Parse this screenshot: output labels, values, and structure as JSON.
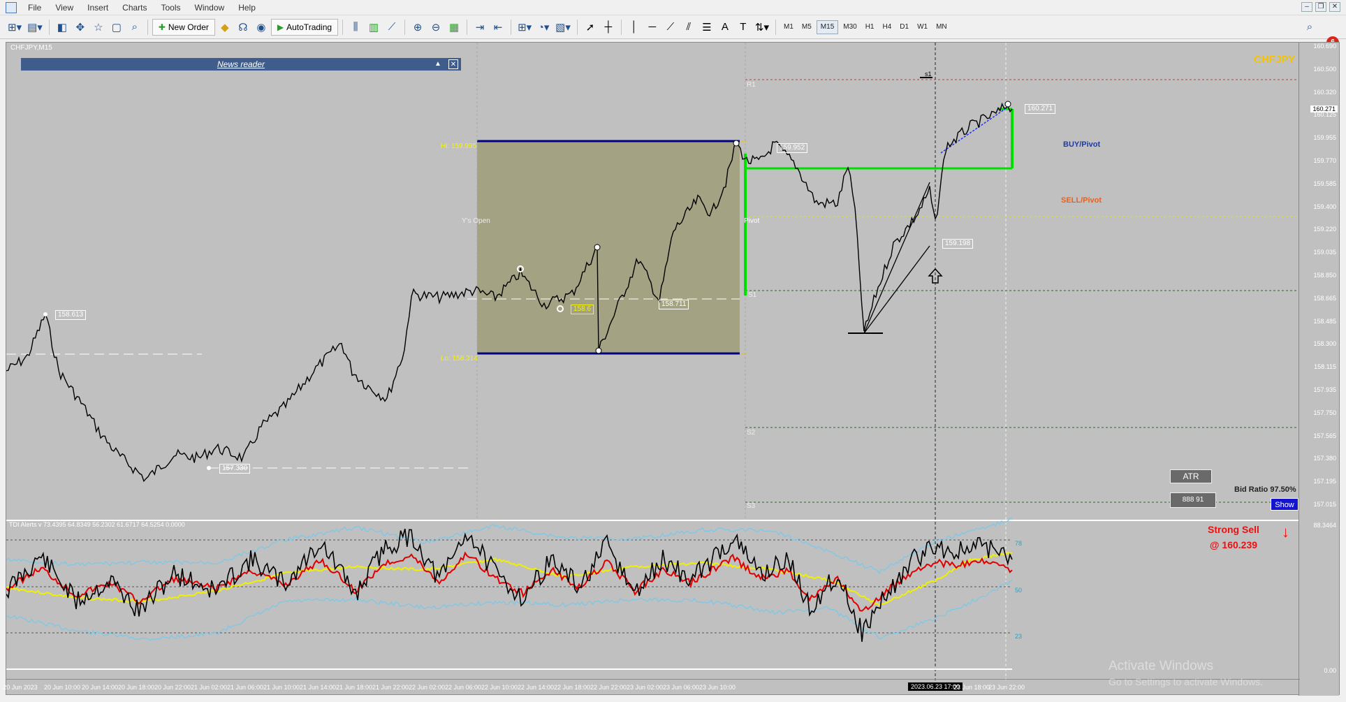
{
  "menu": [
    "File",
    "View",
    "Insert",
    "Charts",
    "Tools",
    "Window",
    "Help"
  ],
  "toolbar": {
    "new_order": "New Order",
    "autotrading": "AutoTrading",
    "timeframes": [
      "M1",
      "M5",
      "M15",
      "M30",
      "H1",
      "H4",
      "D1",
      "W1",
      "MN"
    ],
    "active_timeframe": "M15",
    "notifications": "6"
  },
  "chart": {
    "title": "CHFJPY,M15",
    "symbol": "CHFJPY",
    "news_reader": "News reader",
    "hi_label": "Hi: 159.995",
    "lo_label": "Lo: 158.314",
    "ys_open": "Y's Open",
    "pivot_label": "Pivot",
    "r1": "R1",
    "s1": "S1",
    "s2": "S2",
    "s3": "S3",
    "s1_marker": "s1",
    "buy_pivot": "BUY/Pivot",
    "sell_pivot": "SELL/Pivot",
    "tags": [
      "158.613",
      "157.330",
      "158.6",
      "158.711",
      "159.952",
      "159.198",
      "160.271"
    ],
    "atr_button": "ATR",
    "atr_value": "888 91",
    "bid_ratio": "Bid Ratio 97.50%",
    "show_button": "Show",
    "current_price": "160.271",
    "price_axis": [
      "160.690",
      "160.500",
      "160.320",
      "160.125",
      "159.955",
      "159.770",
      "159.585",
      "159.400",
      "159.220",
      "159.035",
      "158.850",
      "158.665",
      "158.485",
      "158.300",
      "158.115",
      "157.935",
      "157.750",
      "157.565",
      "157.380",
      "157.195",
      "157.015"
    ],
    "colors": {
      "background": "#c0c0c0",
      "box": "#a3a283",
      "green": "#00e000",
      "navy": "#000080",
      "yellow": "#f5c400"
    }
  },
  "indicator": {
    "title": "TDI Alerts v 73.4395 64.8349 56.2302 61.6717 64.5254 0.0000",
    "levels": [
      "78",
      "50",
      "23"
    ],
    "axis_top": "88.3464",
    "axis_bottom": "0.00",
    "strong_sell": "Strong Sell",
    "sell_price": "@ 160.239",
    "arrow": "down-arrow-icon"
  },
  "time_axis": {
    "labels": [
      "20 Jun 2023",
      "20 Jun 10:00",
      "20 Jun 14:00",
      "20 Jun 18:00",
      "20 Jun 22:00",
      "21 Jun 02:00",
      "21 Jun 06:00",
      "21 Jun 10:00",
      "21 Jun 14:00",
      "21 Jun 18:00",
      "21 Jun 22:00",
      "22 Jun 02:00",
      "22 Jun 06:00",
      "22 Jun 10:00",
      "22 Jun 14:00",
      "22 Jun 18:00",
      "22 Jun 22:00",
      "23 Jun 02:00",
      "23 Jun 06:00",
      "23 Jun 10:00",
      "23 Jun 18:00",
      "23 Jun 22:00"
    ],
    "cursor": "2023.06.23 17:00"
  },
  "watermark": {
    "title": "Activate Windows",
    "subtitle": "Go to Settings to activate Windows."
  }
}
